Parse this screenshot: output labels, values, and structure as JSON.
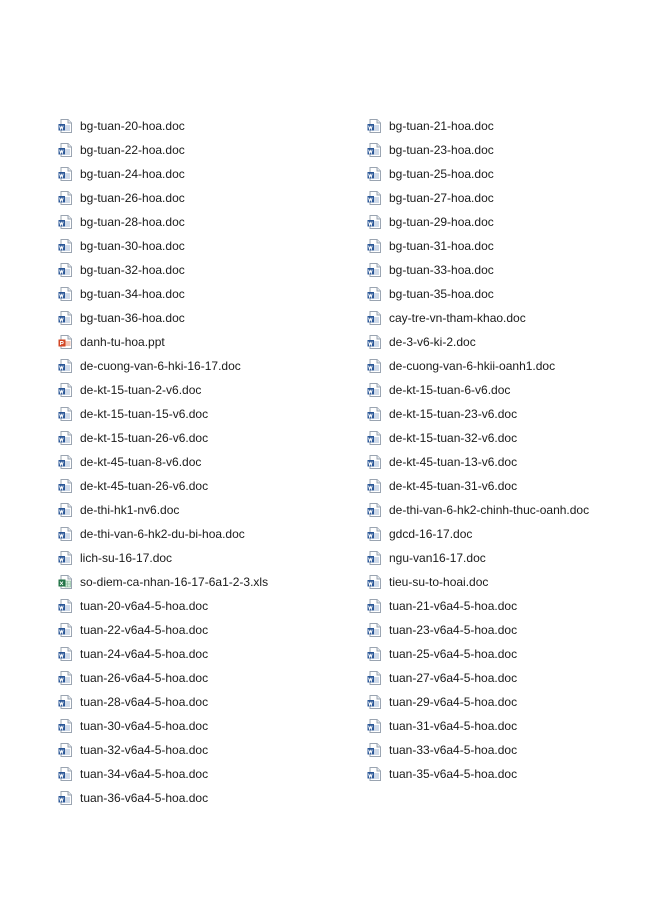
{
  "files_left": [
    {
      "name": "bg-tuan-20-hoa.doc",
      "icon": "word-doc-icon"
    },
    {
      "name": "bg-tuan-22-hoa.doc",
      "icon": "word-doc-icon"
    },
    {
      "name": "bg-tuan-24-hoa.doc",
      "icon": "word-doc-icon"
    },
    {
      "name": "bg-tuan-26-hoa.doc",
      "icon": "word-doc-icon"
    },
    {
      "name": "bg-tuan-28-hoa.doc",
      "icon": "word-doc-icon"
    },
    {
      "name": "bg-tuan-30-hoa.doc",
      "icon": "word-doc-icon"
    },
    {
      "name": "bg-tuan-32-hoa.doc",
      "icon": "word-doc-icon"
    },
    {
      "name": "bg-tuan-34-hoa.doc",
      "icon": "word-doc-icon"
    },
    {
      "name": "bg-tuan-36-hoa.doc",
      "icon": "word-doc-icon"
    },
    {
      "name": "danh-tu-hoa.ppt",
      "icon": "powerpoint-icon"
    },
    {
      "name": "de-cuong-van-6-hki-16-17.doc",
      "icon": "word-doc-icon"
    },
    {
      "name": "de-kt-15-tuan-2-v6.doc",
      "icon": "word-doc-icon"
    },
    {
      "name": "de-kt-15-tuan-15-v6.doc",
      "icon": "word-doc-icon"
    },
    {
      "name": "de-kt-15-tuan-26-v6.doc",
      "icon": "word-doc-icon"
    },
    {
      "name": "de-kt-45-tuan-8-v6.doc",
      "icon": "word-doc-icon"
    },
    {
      "name": "de-kt-45-tuan-26-v6.doc",
      "icon": "word-doc-icon"
    },
    {
      "name": "de-thi-hk1-nv6.doc",
      "icon": "word-doc-icon"
    },
    {
      "name": "de-thi-van-6-hk2-du-bi-hoa.doc",
      "icon": "word-doc-icon"
    },
    {
      "name": "lich-su-16-17.doc",
      "icon": "word-doc-icon"
    },
    {
      "name": "so-diem-ca-nhan-16-17-6a1-2-3.xls",
      "icon": "excel-icon"
    },
    {
      "name": "tuan-20-v6a4-5-hoa.doc",
      "icon": "word-doc-icon"
    },
    {
      "name": "tuan-22-v6a4-5-hoa.doc",
      "icon": "word-doc-icon"
    },
    {
      "name": "tuan-24-v6a4-5-hoa.doc",
      "icon": "word-doc-icon"
    },
    {
      "name": "tuan-26-v6a4-5-hoa.doc",
      "icon": "word-doc-icon"
    },
    {
      "name": "tuan-28-v6a4-5-hoa.doc",
      "icon": "word-doc-icon"
    },
    {
      "name": "tuan-30-v6a4-5-hoa.doc",
      "icon": "word-doc-icon"
    },
    {
      "name": "tuan-32-v6a4-5-hoa.doc",
      "icon": "word-doc-icon"
    },
    {
      "name": "tuan-34-v6a4-5-hoa.doc",
      "icon": "word-doc-icon"
    },
    {
      "name": "tuan-36-v6a4-5-hoa.doc",
      "icon": "word-doc-icon"
    }
  ],
  "files_right": [
    {
      "name": "bg-tuan-21-hoa.doc",
      "icon": "word-doc-icon"
    },
    {
      "name": "bg-tuan-23-hoa.doc",
      "icon": "word-doc-icon"
    },
    {
      "name": "bg-tuan-25-hoa.doc",
      "icon": "word-doc-icon"
    },
    {
      "name": "bg-tuan-27-hoa.doc",
      "icon": "word-doc-icon"
    },
    {
      "name": "bg-tuan-29-hoa.doc",
      "icon": "word-doc-icon"
    },
    {
      "name": "bg-tuan-31-hoa.doc",
      "icon": "word-doc-icon"
    },
    {
      "name": "bg-tuan-33-hoa.doc",
      "icon": "word-doc-icon"
    },
    {
      "name": "bg-tuan-35-hoa.doc",
      "icon": "word-doc-icon"
    },
    {
      "name": "cay-tre-vn-tham-khao.doc",
      "icon": "word-doc-icon"
    },
    {
      "name": "de-3-v6-ki-2.doc",
      "icon": "word-doc-icon"
    },
    {
      "name": "de-cuong-van-6-hkii-oanh1.doc",
      "icon": "word-doc-icon"
    },
    {
      "name": "de-kt-15-tuan-6-v6.doc",
      "icon": "word-doc-icon"
    },
    {
      "name": "de-kt-15-tuan-23-v6.doc",
      "icon": "word-doc-icon"
    },
    {
      "name": "de-kt-15-tuan-32-v6.doc",
      "icon": "word-doc-icon"
    },
    {
      "name": "de-kt-45-tuan-13-v6.doc",
      "icon": "word-doc-icon"
    },
    {
      "name": "de-kt-45-tuan-31-v6.doc",
      "icon": "word-doc-icon"
    },
    {
      "name": "de-thi-van-6-hk2-chinh-thuc-oanh.doc",
      "icon": "word-doc-icon"
    },
    {
      "name": "gdcd-16-17.doc",
      "icon": "word-doc-icon"
    },
    {
      "name": "ngu-van16-17.doc",
      "icon": "word-doc-icon"
    },
    {
      "name": "tieu-su-to-hoai.doc",
      "icon": "word-doc-icon"
    },
    {
      "name": "tuan-21-v6a4-5-hoa.doc",
      "icon": "word-doc-icon"
    },
    {
      "name": "tuan-23-v6a4-5-hoa.doc",
      "icon": "word-doc-icon"
    },
    {
      "name": "tuan-25-v6a4-5-hoa.doc",
      "icon": "word-doc-icon"
    },
    {
      "name": "tuan-27-v6a4-5-hoa.doc",
      "icon": "word-doc-icon"
    },
    {
      "name": "tuan-29-v6a4-5-hoa.doc",
      "icon": "word-doc-icon"
    },
    {
      "name": "tuan-31-v6a4-5-hoa.doc",
      "icon": "word-doc-icon"
    },
    {
      "name": "tuan-33-v6a4-5-hoa.doc",
      "icon": "word-doc-icon"
    },
    {
      "name": "tuan-35-v6a4-5-hoa.doc",
      "icon": "word-doc-icon"
    }
  ],
  "colors": {
    "word_blue": "#2b5797",
    "powerpoint_red": "#d24726",
    "excel_green": "#217346",
    "text": "#1a1a1a"
  }
}
